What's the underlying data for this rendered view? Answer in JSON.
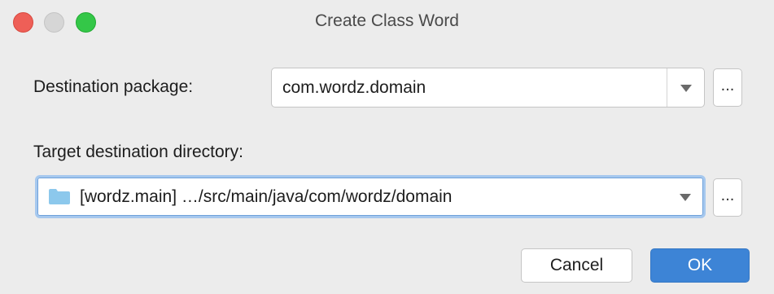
{
  "window": {
    "title": "Create Class Word"
  },
  "form": {
    "destination_package_label": "Destination package:",
    "destination_package_value": "com.wordz.domain",
    "target_directory_label": "Target destination directory:",
    "target_directory_value": "[wordz.main] …/src/main/java/com/wordz/domain",
    "browse_label": "...",
    "folder_icon": "folder-icon",
    "dropdown_icon": "chevron-down-icon"
  },
  "buttons": {
    "cancel_label": "Cancel",
    "ok_label": "OK"
  },
  "colors": {
    "accent": "#3d84d6",
    "focus_ring": "#a6c8ee",
    "close": "#ee5f57",
    "minimize": "#d6d6d6",
    "maximize": "#34c748",
    "folder": "#8cc8ec"
  }
}
